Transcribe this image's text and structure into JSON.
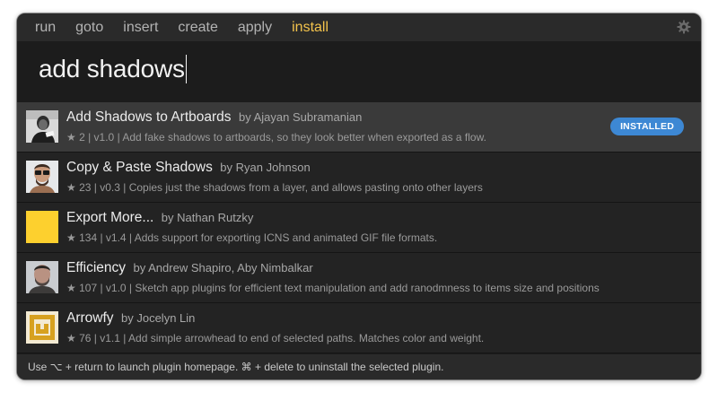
{
  "tabs": [
    {
      "label": "run"
    },
    {
      "label": "goto"
    },
    {
      "label": "insert"
    },
    {
      "label": "create"
    },
    {
      "label": "apply"
    },
    {
      "label": "install",
      "active": true
    }
  ],
  "settings_icon": "gear-icon",
  "search": {
    "value": "add shadows"
  },
  "results": [
    {
      "title": "Add Shadows to Artboards",
      "author": "by Ajayan Subramanian",
      "meta": "★ 2 | v1.0 | Add fake shadows to artboards, so they look better when exported as a flow.",
      "badge": "INSTALLED",
      "thumbnail": "avatar-photo-bw"
    },
    {
      "title": "Copy & Paste Shadows",
      "author": "by Ryan Johnson",
      "meta": "★ 23 | v0.3 | Copies just the shadows from a layer, and allows pasting onto other layers",
      "thumbnail": "avatar-photo-color"
    },
    {
      "title": "Export More...",
      "author": "by Nathan Rutzky",
      "meta": "★ 134 | v1.4 | Adds support for exporting ICNS and animated GIF file formats.",
      "thumbnail": "yellow-square",
      "thumbnail_color": "#fdd02e"
    },
    {
      "title": "Efficiency",
      "author": "by Andrew Shapiro, Aby Nimbalkar",
      "meta": "★ 107 | v1.0 | Sketch app plugins for efficient text manipulation and add ranodmness to items size and positions",
      "thumbnail": "avatar-photo-gray"
    },
    {
      "title": "Arrowfy",
      "author": "by Jocelyn Lin",
      "meta": "★ 76 | v1.1 | Add simple arrowhead to end of selected paths. Matches color and weight.",
      "thumbnail": "arrowfy-logo",
      "thumbnail_color": "#d7a11f"
    }
  ],
  "footer": {
    "hint": "Use ⌥ + return to launch plugin homepage. ⌘ + delete to uninstall the selected plugin."
  },
  "colors": {
    "accent_tab": "#f3c34c",
    "badge": "#3d88d4",
    "selected_row": "#3a3a3a"
  }
}
